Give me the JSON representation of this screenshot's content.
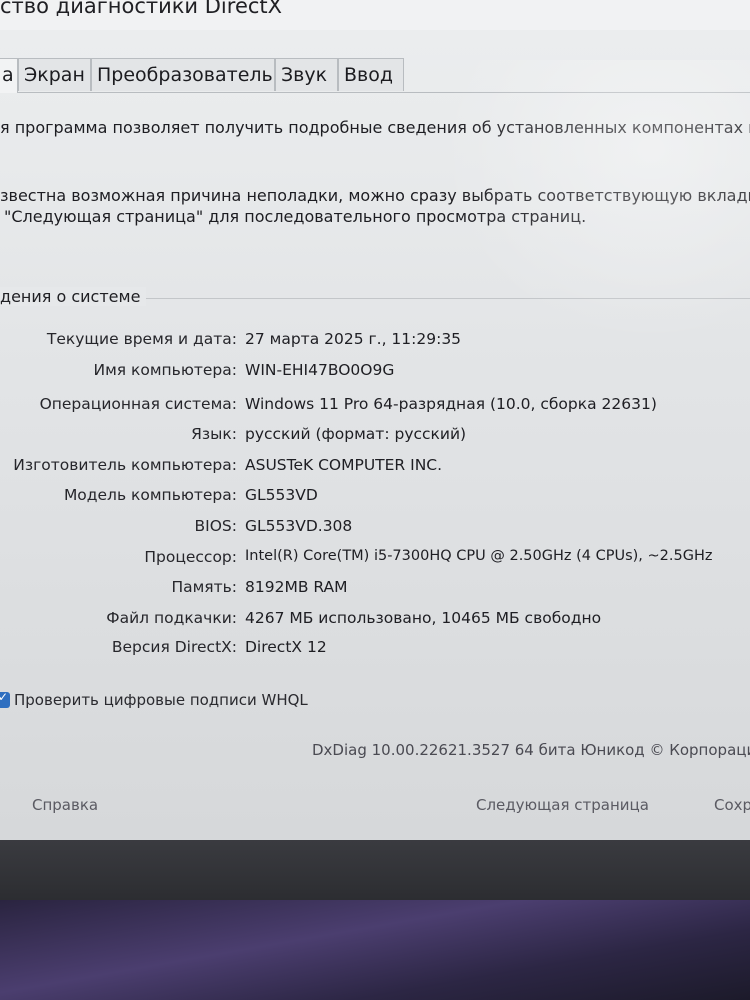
{
  "window": {
    "title": "ство диагностики DirectX"
  },
  "tabs": [
    {
      "label": "а"
    },
    {
      "label": "Экран"
    },
    {
      "label": "Преобразователь"
    },
    {
      "label": "Звук"
    },
    {
      "label": "Ввод"
    }
  ],
  "intro": {
    "line1": "я программа позволяет получить подробные сведения об установленных компонентах и дра",
    "line2": "звестна возможная причина неполадки, можно сразу выбрать соответствующую вкладку. В",
    "line3": "\"Следующая страница\" для последовательного просмотра страниц."
  },
  "system_info": {
    "title": "дения о системе",
    "rows": [
      {
        "label": "Текущие время и дата:",
        "value": "27 марта 2025 г., 11:29:35"
      },
      {
        "label": "Имя компьютера:",
        "value": "WIN-EHI47BO0O9G"
      },
      {
        "label": "Операционная система:",
        "value": "Windows 11 Pro 64-разрядная (10.0, сборка 22631)"
      },
      {
        "label": "Язык:",
        "value": "русский (формат: русский)"
      },
      {
        "label": "Изготовитель компьютера:",
        "value": "ASUSTeK COMPUTER INC."
      },
      {
        "label": "Модель компьютера:",
        "value": "GL553VD"
      },
      {
        "label": "BIOS:",
        "value": "GL553VD.308"
      },
      {
        "label": "Процессор:",
        "value": "Intel(R) Core(TM) i5-7300HQ CPU @ 2.50GHz (4 CPUs), ~2.5GHz"
      },
      {
        "label": "Память:",
        "value": "8192MB RAM"
      },
      {
        "label": "Файл подкачки:",
        "value": "4267 МБ использовано, 10465 МБ свободно"
      },
      {
        "label": "Версия DirectX:",
        "value": "DirectX 12"
      }
    ]
  },
  "whql": {
    "label": "Проверить цифровые подписи WHQL",
    "checked": true
  },
  "footer": {
    "version": "DxDiag 10.00.22621.3527 64 бита Юникод © Корпорация Ma",
    "help": "Справка",
    "next": "Следующая страница",
    "save": "Сохр"
  }
}
